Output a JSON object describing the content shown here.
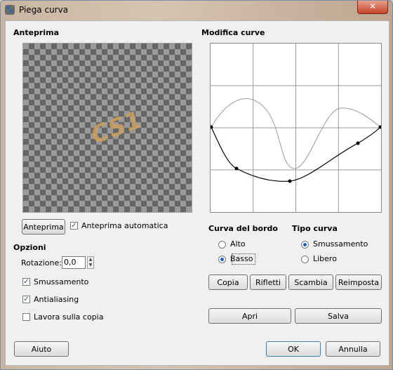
{
  "window": {
    "title": "Piega curva",
    "close_glyph": "✕",
    "app_icon": "gimp-icon"
  },
  "preview": {
    "title": "Anteprima",
    "art_text": "CS1",
    "preview_button": "Anteprima",
    "auto_preview_label": "Anteprima automatica",
    "auto_preview_checked": true
  },
  "options": {
    "title": "Opzioni",
    "rotation_label": "Rotazione:",
    "rotation_value": "0,0",
    "smoothing_label": "Smussamento",
    "smoothing_checked": true,
    "antialiasing_label": "Antialiasing",
    "antialiasing_checked": true,
    "work_on_copy_label": "Lavora sulla copia",
    "work_on_copy_checked": false
  },
  "curves": {
    "title": "Modifica curve",
    "upper_curve_color": "#9a9a9a",
    "lower_curve_color": "#000000"
  },
  "edge": {
    "title": "Curva del bordo",
    "top_label": "Alto",
    "bottom_label": "Basso",
    "selected": "Basso"
  },
  "curve_type": {
    "title": "Tipo curva",
    "smooth_label": "Smussamento",
    "free_label": "Libero",
    "selected": "Smussamento"
  },
  "actions": {
    "copy": "Copia",
    "mirror": "Rifletti",
    "swap": "Scambia",
    "reset": "Reimposta",
    "open": "Apri",
    "save": "Salva"
  },
  "footer": {
    "help": "Aiuto",
    "ok": "OK",
    "cancel": "Annulla"
  }
}
